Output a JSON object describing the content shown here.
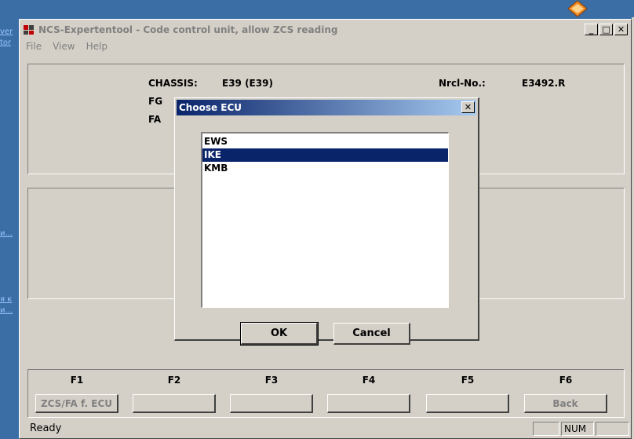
{
  "desktop": {
    "links": [
      "ver",
      "tor",
      "и...",
      "я к",
      "и..."
    ]
  },
  "window": {
    "title": "NCS-Expertentool - Code control unit, allow ZCS reading",
    "controls": {
      "minimize": "_",
      "maximize": "□",
      "close": "✕"
    },
    "menu": [
      "File",
      "View",
      "Help"
    ]
  },
  "vehicle": {
    "chassis_label": "CHASSIS:",
    "chassis_value": "E39 (E39)",
    "fg_label": "FG",
    "fa_label": "FA",
    "nrcl_label": "Nrcl-No.:",
    "nrcl_value": "E3492.R"
  },
  "function_keys": [
    {
      "key": "F1",
      "label": "ZCS/FA f. ECU"
    },
    {
      "key": "F2",
      "label": ""
    },
    {
      "key": "F3",
      "label": ""
    },
    {
      "key": "F4",
      "label": ""
    },
    {
      "key": "F5",
      "label": ""
    },
    {
      "key": "F6",
      "label": "Back"
    }
  ],
  "status": {
    "text": "Ready",
    "num": "NUM"
  },
  "dialog": {
    "title": "Choose ECU",
    "close": "✕",
    "items": [
      "EWS",
      "IKE",
      "KMB"
    ],
    "selected": "IKE",
    "ok": "OK",
    "cancel": "Cancel"
  },
  "colors": {
    "desktop": "#3a6ea5",
    "window_bg": "#d4d0c8",
    "title_active": "#0a246a",
    "selection": "#0a246a"
  },
  "icons": {
    "app": "ncs-app-icon",
    "tray": "warning-diamond-icon"
  }
}
